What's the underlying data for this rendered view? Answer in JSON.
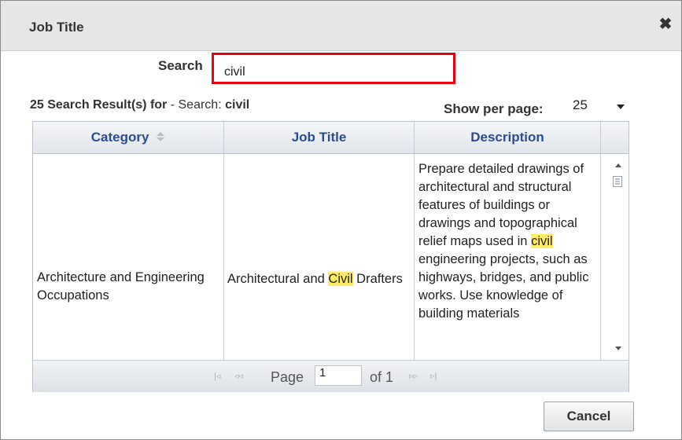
{
  "dialog": {
    "title": "Job Title",
    "close_icon": "close-icon"
  },
  "search": {
    "label": "Search",
    "value": "civil",
    "highlight_color": "#e8000b"
  },
  "results": {
    "count_text": "25 Search Result(s) for",
    "separator": " - ",
    "query_prefix": "Search:",
    "query": "civil"
  },
  "per_page": {
    "label": "Show per page:",
    "value": "25"
  },
  "grid": {
    "columns": [
      {
        "label": "Category",
        "sort_icon": "sort-icon"
      },
      {
        "label": "Job Title"
      },
      {
        "label": "Description"
      }
    ],
    "rows": [
      {
        "category": "Architecture and Engineering Occupations",
        "job_title_before": "Architectural and ",
        "job_title_match": "Civil",
        "job_title_after": " Drafters",
        "description_before": "Prepare detailed drawings of architectural and structural features of buildings or drawings and topographical relief maps used in ",
        "description_match": "civil",
        "description_after": " engineering projects, such as highways, bridges, and public works. Use knowledge of building materials"
      }
    ],
    "match_highlight_color": "#ffec66"
  },
  "pager": {
    "page_label": "Page",
    "page_value": "1",
    "of_label": "of 1"
  },
  "buttons": {
    "cancel": "Cancel"
  }
}
